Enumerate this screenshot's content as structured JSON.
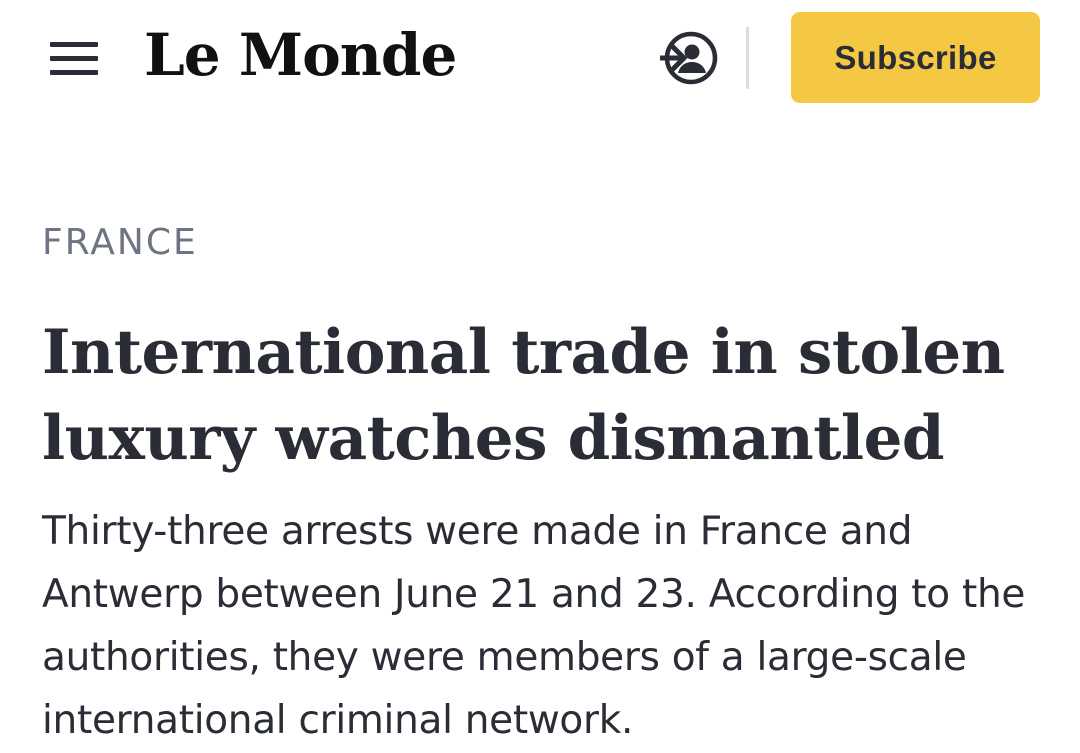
{
  "header": {
    "menu_icon": "hamburger-menu-icon",
    "logo_text": "Le Monde",
    "login_icon": "login-user-icon",
    "subscribe_label": "Subscribe",
    "subscribe_color": "#f4c842"
  },
  "article": {
    "section": "FRANCE",
    "headline": "International trade in stolen luxury watches dismantled",
    "standfirst": "Thirty-three arrests were made in France and Antwerp between June 21 and 23. According to the authorities, they were members of a large-scale international criminal network."
  },
  "colors": {
    "text": "#2a2d36",
    "section": "#6f7485",
    "divider": "#dcdde0"
  }
}
